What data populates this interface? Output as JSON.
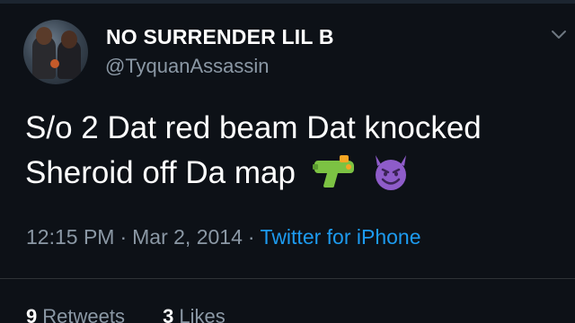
{
  "tweet": {
    "display_name": "NO SURRENDER LIL B",
    "handle": "@TyquanAssassin",
    "text_line1": "S/o 2 Dat red beam Dat knocked",
    "text_line2": "Sheroid off Da map",
    "emojis": [
      "water-pistol-icon",
      "smiling-devil-icon"
    ],
    "time": "12:15 PM",
    "date": "Mar 2, 2014",
    "separator": "·",
    "source": "Twitter for iPhone",
    "retweets_count": "9",
    "retweets_label": "Retweets",
    "likes_count": "3",
    "likes_label": "Likes"
  },
  "colors": {
    "background": "#0d1117",
    "secondary_text": "#8b98a5",
    "link": "#1d9bf0",
    "divider": "#2f3336"
  }
}
